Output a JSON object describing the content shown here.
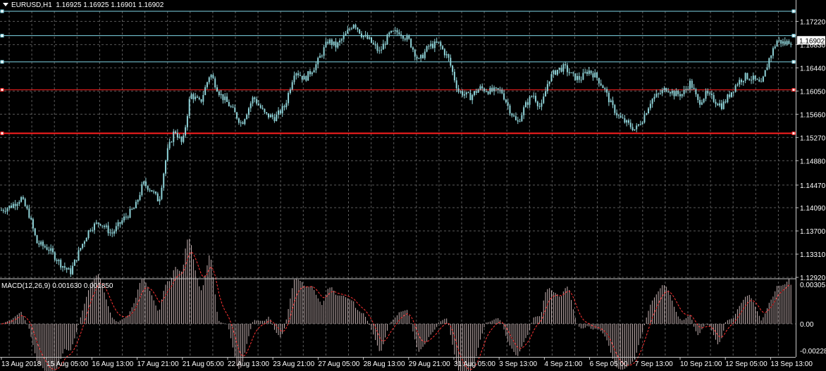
{
  "main_header": {
    "symbol": "EURUSD,H1",
    "ohlc": "1.16925 1.16925 1.16901 1.16902"
  },
  "macd_header": {
    "label": "MACD(12,26,9) 0.001630 0.001850"
  },
  "colors": {
    "background": "#000000",
    "grid": "#5a5a5a",
    "candle": "#8fd3d8",
    "cyan_line": "#7fd6e6",
    "red_line": "#ff2020",
    "macd_bars": "#c8b4b4",
    "macd_signal": "#ff3333",
    "current_price_bg": "#ffffff"
  },
  "chart_data": {
    "type": "candlestick",
    "symbol": "EURUSD",
    "timeframe": "H1",
    "price_axis": {
      "ticks": [
        "1.17220",
        "1.16830",
        "1.16440",
        "1.16050",
        "1.15660",
        "1.15270",
        "1.14880",
        "1.14470",
        "1.14090",
        "1.13700",
        "1.13310",
        "1.12920"
      ],
      "range": [
        1.1292,
        1.1739
      ]
    },
    "current_price": "1.16902",
    "horizontal_levels": [
      {
        "price": 1.1739,
        "color": "cyan"
      },
      {
        "price": 1.1698,
        "color": "cyan"
      },
      {
        "price": 1.1654,
        "color": "cyan"
      },
      {
        "price": 1.1607,
        "color": "red"
      },
      {
        "price": 1.1534,
        "color": "red"
      }
    ],
    "time_axis": [
      "13 Aug 2018",
      "15 Aug 05:00",
      "16 Aug 13:00",
      "17 Aug 21:00",
      "21 Aug 05:00",
      "22 Aug 13:00",
      "23 Aug 21:00",
      "27 Aug 05:00",
      "28 Aug 13:00",
      "29 Aug 21:00",
      "31 Aug 05:00",
      "3 Sep 13:00",
      "4 Sep 21:00",
      "6 Sep 05:00",
      "7 Sep 13:00",
      "10 Sep 21:00",
      "12 Sep 05:00",
      "13 Sep 13:00"
    ],
    "close_path": [
      [
        0,
        1.1405
      ],
      [
        5,
        1.1412
      ],
      [
        10,
        1.1425
      ],
      [
        14,
        1.1398
      ],
      [
        18,
        1.135
      ],
      [
        24,
        1.134
      ],
      [
        30,
        1.1315
      ],
      [
        35,
        1.13
      ],
      [
        40,
        1.134
      ],
      [
        45,
        1.1375
      ],
      [
        50,
        1.1385
      ],
      [
        56,
        1.1365
      ],
      [
        62,
        1.139
      ],
      [
        68,
        1.141
      ],
      [
        72,
        1.145
      ],
      [
        76,
        1.144
      ],
      [
        80,
        1.142
      ],
      [
        84,
        1.15
      ],
      [
        88,
        1.154
      ],
      [
        92,
        1.1515
      ],
      [
        96,
        1.16
      ],
      [
        101,
        1.1585
      ],
      [
        106,
        1.1635
      ],
      [
        111,
        1.16
      ],
      [
        116,
        1.158
      ],
      [
        122,
        1.155
      ],
      [
        128,
        1.1595
      ],
      [
        134,
        1.1565
      ],
      [
        139,
        1.156
      ],
      [
        144,
        1.158
      ],
      [
        149,
        1.164
      ],
      [
        154,
        1.1625
      ],
      [
        160,
        1.165
      ],
      [
        166,
        1.169
      ],
      [
        170,
        1.168
      ],
      [
        175,
        1.17
      ],
      [
        179,
        1.172
      ],
      [
        183,
        1.17
      ],
      [
        187,
        1.169
      ],
      [
        192,
        1.167
      ],
      [
        197,
        1.17
      ],
      [
        202,
        1.1705
      ],
      [
        207,
        1.169
      ],
      [
        212,
        1.1655
      ],
      [
        217,
        1.168
      ],
      [
        222,
        1.1685
      ],
      [
        227,
        1.166
      ],
      [
        232,
        1.1605
      ],
      [
        238,
        1.1595
      ],
      [
        243,
        1.161
      ],
      [
        248,
        1.1605
      ],
      [
        254,
        1.1605
      ],
      [
        258,
        1.1575
      ],
      [
        262,
        1.155
      ],
      [
        266,
        1.158
      ],
      [
        270,
        1.16
      ],
      [
        274,
        1.1575
      ],
      [
        278,
        1.1625
      ],
      [
        282,
        1.164
      ],
      [
        286,
        1.1645
      ],
      [
        290,
        1.163
      ],
      [
        294,
        1.1625
      ],
      [
        298,
        1.164
      ],
      [
        302,
        1.163
      ],
      [
        306,
        1.161
      ],
      [
        310,
        1.158
      ],
      [
        314,
        1.156
      ],
      [
        318,
        1.155
      ],
      [
        322,
        1.154
      ],
      [
        326,
        1.156
      ],
      [
        330,
        1.159
      ],
      [
        334,
        1.16
      ],
      [
        338,
        1.161
      ],
      [
        342,
        1.16
      ],
      [
        346,
        1.16
      ],
      [
        350,
        1.162
      ],
      [
        354,
        1.1585
      ],
      [
        358,
        1.16
      ],
      [
        362,
        1.159
      ],
      [
        366,
        1.158
      ],
      [
        370,
        1.16
      ],
      [
        374,
        1.162
      ],
      [
        378,
        1.163
      ],
      [
        382,
        1.1625
      ],
      [
        386,
        1.1615
      ],
      [
        390,
        1.166
      ],
      [
        394,
        1.169
      ],
      [
        398,
        1.1685
      ],
      [
        402,
        1.1692
      ]
    ]
  }
}
